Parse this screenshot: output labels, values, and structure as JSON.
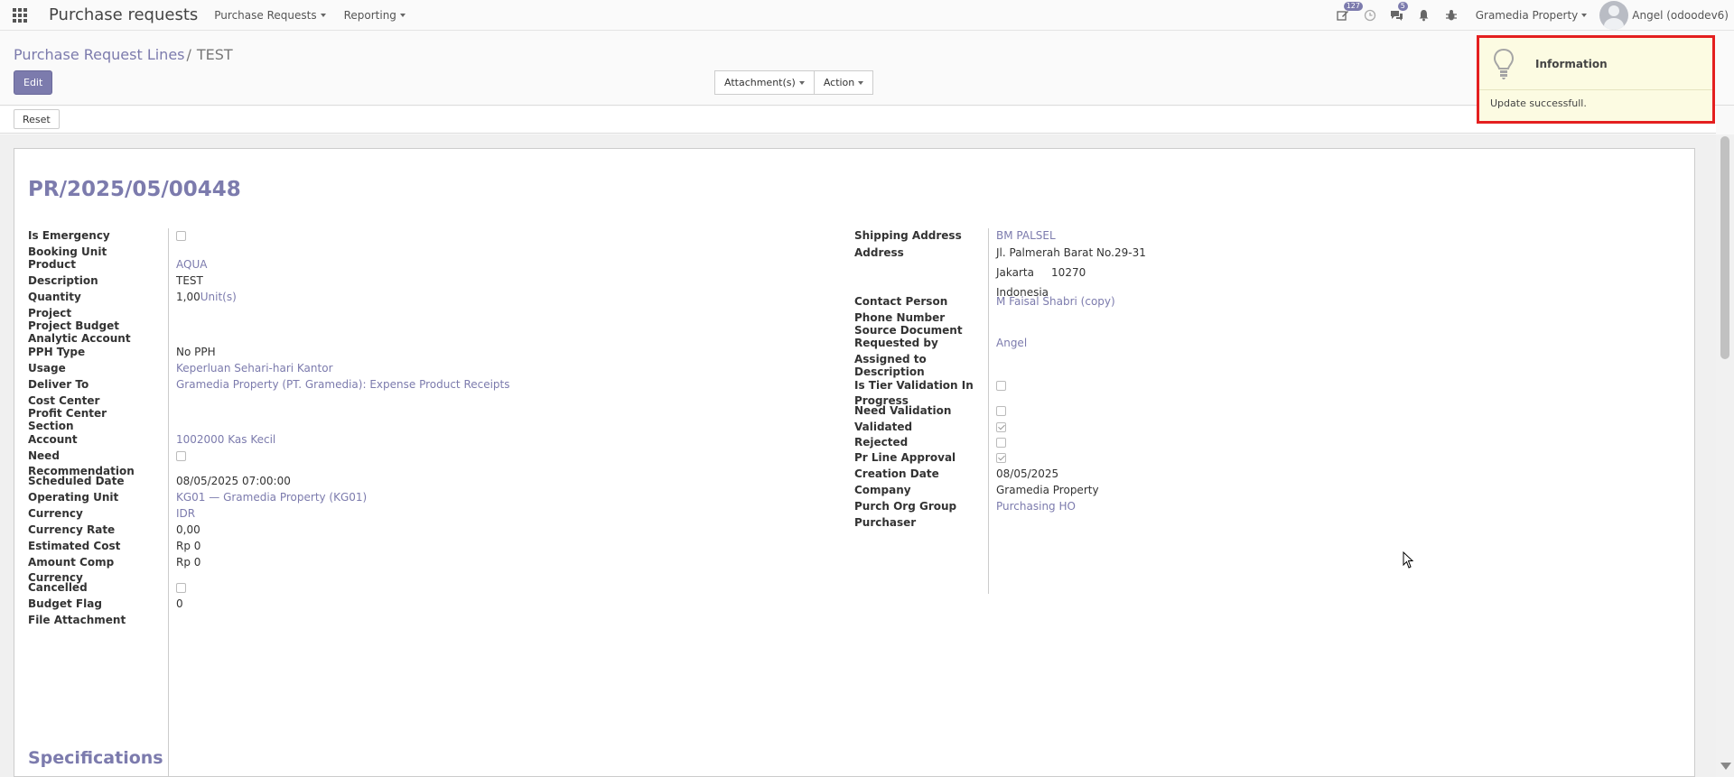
{
  "navbar": {
    "app_title": "Purchase requests",
    "menus": [
      "Purchase Requests",
      "Reporting"
    ],
    "activity_count": "127",
    "messages_count": "5",
    "company": "Gramedia Property",
    "user": "Angel (odoodev6)"
  },
  "control_panel": {
    "breadcrumb_parent": "Purchase Request Lines",
    "breadcrumb_sep": "/",
    "breadcrumb_current": "TEST",
    "edit_label": "Edit",
    "attachments_label": "Attachment(s)",
    "action_label": "Action"
  },
  "statusbar": {
    "reset_label": "Reset"
  },
  "form": {
    "title": "PR/2025/05/00448",
    "left": [
      {
        "label": "Is Emergency",
        "type": "checkbox",
        "checked": false
      },
      {
        "label": "Booking Unit",
        "value": ""
      },
      {
        "label": "Product",
        "value": "AQUA",
        "link": true
      },
      {
        "label": "Description",
        "value": "TEST"
      },
      {
        "label": "Quantity",
        "value": "1,00",
        "unit": "Unit(s)"
      },
      {
        "label": "Project",
        "value": ""
      },
      {
        "label": "Project Budget",
        "value": ""
      },
      {
        "label": "Analytic Account",
        "value": ""
      },
      {
        "label": "PPH Type",
        "value": "No PPH"
      },
      {
        "label": "Usage",
        "value": "Keperluan Sehari-hari Kantor",
        "link": true
      },
      {
        "label": "Deliver To",
        "value": "Gramedia Property (PT. Gramedia): Expense Product Receipts",
        "link": true
      },
      {
        "label": "Cost Center",
        "value": ""
      },
      {
        "label": "Profit Center",
        "value": ""
      },
      {
        "label": "Section",
        "value": ""
      },
      {
        "label": "Account",
        "value": "1002000 Kas Kecil",
        "link": true
      },
      {
        "label": "Need Recommendation",
        "type": "checkbox",
        "checked": false
      },
      {
        "label": "Scheduled Date",
        "value": "08/05/2025 07:00:00"
      },
      {
        "label": "Operating Unit",
        "value": "KG01 — Gramedia Property (KG01)",
        "link": true
      },
      {
        "label": "Currency",
        "value": "IDR",
        "link": true
      },
      {
        "label": "Currency Rate",
        "value": "0,00"
      },
      {
        "label": "Estimated Cost",
        "value": "Rp 0"
      },
      {
        "label": "Amount Comp Currency",
        "value": "Rp 0"
      },
      {
        "label": "Cancelled",
        "type": "checkbox",
        "checked": false
      },
      {
        "label": "Budget Flag",
        "value": "0"
      },
      {
        "label": "File Attachment",
        "value": ""
      }
    ],
    "right": [
      {
        "label": "Shipping Address",
        "value": "BM PALSEL",
        "link": true
      },
      {
        "label": "Address",
        "lines": [
          "Jl. Palmerah Barat No.29-31",
          "Jakarta     10270",
          "Indonesia"
        ]
      },
      {
        "label": "Contact Person",
        "value": "M Faisal Shabri (copy)",
        "link": true
      },
      {
        "label": "Phone Number",
        "value": ""
      },
      {
        "label": "Source Document",
        "value": ""
      },
      {
        "label": "Requested by",
        "value": "Angel",
        "link": true
      },
      {
        "label": "Assigned to",
        "value": ""
      },
      {
        "label": "Description",
        "value": ""
      },
      {
        "label": "Is Tier Validation In Progress",
        "type": "checkbox",
        "checked": false
      },
      {
        "label": "Need Validation",
        "type": "checkbox",
        "checked": false
      },
      {
        "label": "Validated",
        "type": "checkbox",
        "checked": true
      },
      {
        "label": "Rejected",
        "type": "checkbox",
        "checked": false
      },
      {
        "label": "Pr Line Approval",
        "type": "checkbox",
        "checked": true
      },
      {
        "label": "Creation Date",
        "value": "08/05/2025"
      },
      {
        "label": "Company",
        "value": "Gramedia Property"
      },
      {
        "label": "Purch Org Group",
        "value": "Purchasing HO",
        "link": true
      },
      {
        "label": "Purchaser",
        "value": ""
      }
    ],
    "specifications_title": "Specifications"
  },
  "notification": {
    "title": "Information",
    "message": "Update successfull."
  }
}
